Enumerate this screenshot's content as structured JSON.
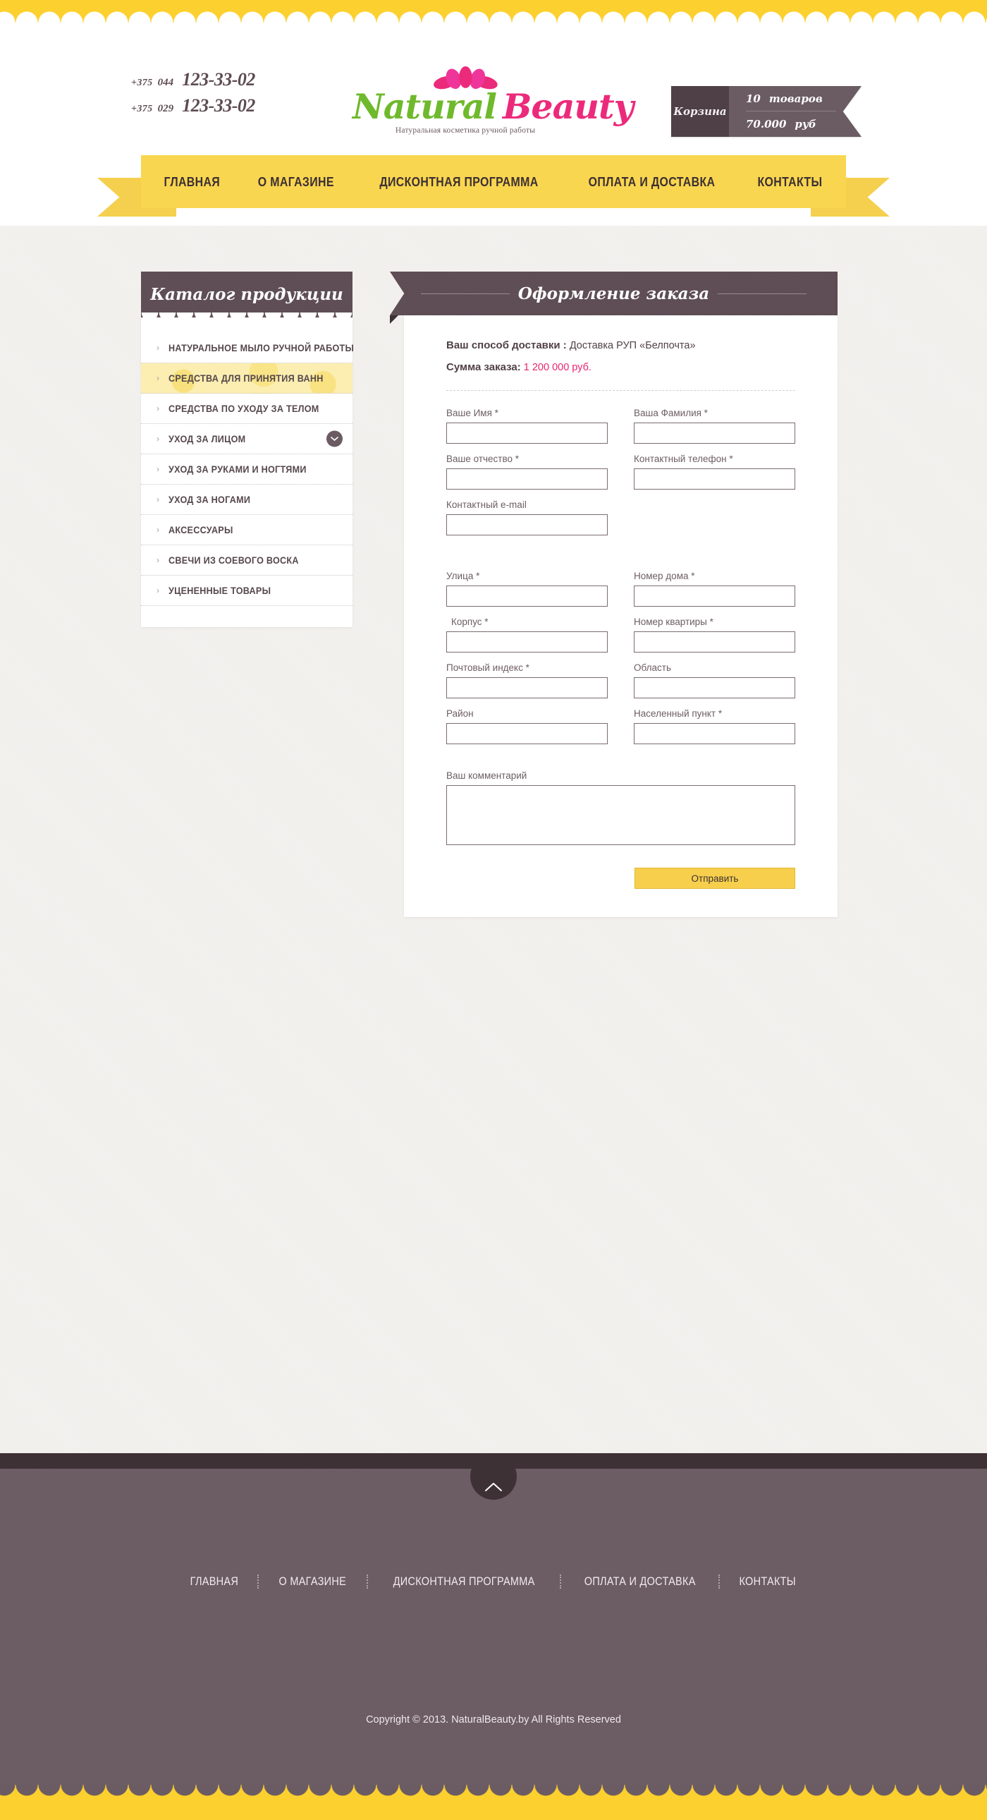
{
  "header": {
    "phones": [
      {
        "country": "+375",
        "operator": "044",
        "number": "123-33-02"
      },
      {
        "country": "+375",
        "operator": "029",
        "number": "123-33-02"
      }
    ],
    "logo": {
      "word1": "Natural",
      "word2": "Beauty",
      "tagline": "Натуральная косметика ручной работы",
      "color_green": "#6fb92c",
      "color_pink": "#ec2a7b"
    },
    "cart": {
      "label": "Корзина",
      "items_count": "10",
      "items_word": "товаров",
      "total": "70.000",
      "currency": "руб"
    }
  },
  "nav": {
    "items": [
      {
        "label": "ГЛАВНАЯ"
      },
      {
        "label": "О МАГАЗИНЕ"
      },
      {
        "label": "ДИСКОНТНАЯ ПРОГРАММА"
      },
      {
        "label": "ОПЛАТА И ДОСТАВКА"
      },
      {
        "label": "КОНТАКТЫ"
      }
    ]
  },
  "sidebar": {
    "title": "Каталог продукции",
    "items": [
      {
        "label": "НАТУРАЛЬНОЕ МЫЛО РУЧНОЙ РАБОТЫ",
        "active": false,
        "has_toggle": false
      },
      {
        "label": "СРЕДСТВА ДЛЯ ПРИНЯТИЯ ВАНН",
        "active": true,
        "has_toggle": false
      },
      {
        "label": "СРЕДСТВА ПО УХОДУ ЗА ТЕЛОМ",
        "active": false,
        "has_toggle": false
      },
      {
        "label": "УХОД ЗА ЛИЦОМ",
        "active": false,
        "has_toggle": true
      },
      {
        "label": "УХОД ЗА РУКАМИ И НОГТЯМИ",
        "active": false,
        "has_toggle": false
      },
      {
        "label": "УХОД ЗА НОГАМИ",
        "active": false,
        "has_toggle": false
      },
      {
        "label": "АКСЕССУАРЫ",
        "active": false,
        "has_toggle": false
      },
      {
        "label": "СВЕЧИ ИЗ СОЕВОГО ВОСКА",
        "active": false,
        "has_toggle": false
      },
      {
        "label": "УЦЕНЕННЫЕ ТОВАРЫ",
        "active": false,
        "has_toggle": false
      }
    ],
    "arrow_glyph": "›"
  },
  "main": {
    "title": "Оформление заказа",
    "delivery_label": "Ваш способ доставки :",
    "delivery_value": "Доставка РУП «Белпочта»",
    "sum_label": "Сумма заказа:",
    "sum_value": "1 200 000 руб.",
    "sum_color": "#e8266f",
    "fields": {
      "first_name": {
        "label": "Ваше Имя *",
        "value": "",
        "placeholder": ""
      },
      "last_name": {
        "label": "Ваша Фамилия *",
        "value": "",
        "placeholder": ""
      },
      "patronymic": {
        "label": "Ваше отчество *",
        "value": "",
        "placeholder": ""
      },
      "phone": {
        "label": "Контактный телефон *",
        "value": "",
        "placeholder": ""
      },
      "email": {
        "label": "Контактный e-mail",
        "value": "",
        "placeholder": ""
      },
      "street": {
        "label": "Улица *",
        "value": "",
        "placeholder": ""
      },
      "house": {
        "label": "Номер дома *",
        "value": "",
        "placeholder": ""
      },
      "building": {
        "label": "Корпус *",
        "value": "",
        "placeholder": ""
      },
      "apartment": {
        "label": "Номер квартиры *",
        "value": "",
        "placeholder": ""
      },
      "postcode": {
        "label": "Почтовый индекс *",
        "value": "",
        "placeholder": ""
      },
      "region": {
        "label": "Область",
        "value": "",
        "placeholder": ""
      },
      "district": {
        "label": "Район",
        "value": "",
        "placeholder": ""
      },
      "locality": {
        "label": "Населенный пункт *",
        "value": "",
        "placeholder": ""
      },
      "comment": {
        "label": "Ваш комментарий",
        "value": "",
        "placeholder": ""
      }
    },
    "submit_label": "Отправить"
  },
  "footer": {
    "nav": [
      {
        "label": "ГЛАВНАЯ"
      },
      {
        "label": "О МАГАЗИНЕ"
      },
      {
        "label": "ДИСКОНТНАЯ ПРОГРАММА"
      },
      {
        "label": "ОПЛАТА И ДОСТАВКА"
      },
      {
        "label": "КОНТАКТЫ"
      }
    ],
    "copyright": "Copyright © 2013. NaturalBeauty.by    All Rights Reserved"
  },
  "colors": {
    "yellow": "#f9d64f",
    "scallop_yellow": "#fcd02e",
    "plum": "#6b5b62",
    "plum_dark": "#5d4c53",
    "pink": "#ec2a7b",
    "green": "#6fb92c"
  }
}
